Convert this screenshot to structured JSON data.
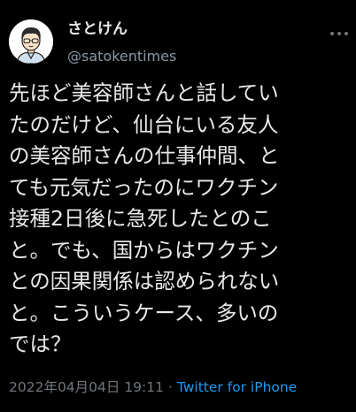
{
  "tweet": {
    "author": {
      "display_name": "さとけん",
      "handle": "@satokentimes"
    },
    "text_lines": [
      "先ほど美容師さんと話してい",
      "たのだけど、仙台にいる友人",
      "の美容師さんの仕事仲間、と",
      "ても元気だったのにワクチン",
      "接種2日後に急死したとのこ",
      "と。でも、国からはワクチン",
      "との因果関係は認められない",
      "と。こういうケース、多いの",
      "では？"
    ],
    "timestamp": "2022年04月04日 19:11",
    "separator": "·",
    "source": "Twitter for iPhone"
  },
  "icons": {
    "avatar": "user-avatar-illustration",
    "more": "more-options-icon"
  },
  "colors": {
    "background": "#000000",
    "text": "#e7e9ea",
    "muted": "#71767b",
    "link": "#1d9bf0"
  }
}
